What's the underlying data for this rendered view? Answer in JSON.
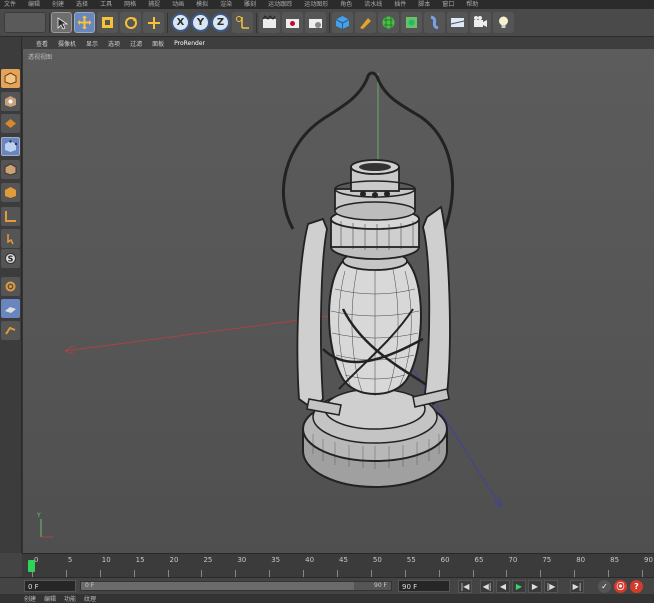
{
  "menubar": {
    "items": [
      "文件",
      "编辑",
      "创建",
      "选择",
      "工具",
      "网格",
      "捕捉",
      "动画",
      "模拟",
      "渲染",
      "雕刻",
      "运动跟踪",
      "运动图形",
      "角色",
      "流水线",
      "插件",
      "脚本",
      "窗口",
      "帮助"
    ]
  },
  "toolbar": {
    "undo_icon": "undo-icon",
    "move_icon": "move-icon",
    "scale_icon": "scale-icon",
    "rotate_icon": "rotate-icon",
    "live_icon": "live-select-icon",
    "x_label": "X",
    "y_label": "Y",
    "z_label": "Z",
    "coord_icon": "coordinate-system-icon",
    "render_icons": [
      "render-view-icon",
      "render-picture-queue-icon",
      "render-settings-icon"
    ],
    "object_icons": [
      "cube-icon",
      "pen-spline-icon",
      "subdivision-surface-icon",
      "array-icon",
      "deformer-icon",
      "scene-environment-icon",
      "camera-icon",
      "light-icon"
    ]
  },
  "viewport_menu": {
    "items": [
      "查看",
      "摄像机",
      "显示",
      "选项",
      "过滤",
      "面板",
      "ProRender"
    ],
    "highlight": "ProRender"
  },
  "left_palette": {
    "icons": [
      "make-editable-icon",
      "model-mode-icon",
      "texture-mode-icon",
      "points-mode-icon",
      "edges-mode-icon",
      "polygons-mode-icon",
      "axis-mode-icon",
      "tweak-mode-icon",
      "snap-icon",
      "soft-selection-icon",
      "workplane-icon",
      "locked-workplane-icon"
    ]
  },
  "viewport": {
    "label": "透视视图",
    "object": "oil-lantern-wireframe"
  },
  "timeline": {
    "ticks": [
      "0",
      "5",
      "10",
      "15",
      "20",
      "25",
      "30",
      "35",
      "40",
      "45",
      "50",
      "55",
      "60",
      "65",
      "70",
      "75",
      "80",
      "85",
      "90"
    ],
    "current_frame": 0
  },
  "transport": {
    "current_field": "0 F",
    "start_field": "0 F",
    "end_field": "90 F",
    "max_field": "90 F",
    "buttons": [
      "first-frame",
      "prev-key",
      "prev-frame",
      "play",
      "next-frame",
      "next-key",
      "last-frame"
    ],
    "button_glyphs": [
      "|◀",
      "◀|",
      "◀",
      "▶",
      "▶",
      "|▶",
      "▶|"
    ],
    "record_glyphs": [
      "✓",
      "⦿",
      "?"
    ]
  },
  "bottom_tabs": {
    "items": [
      "创建",
      "编辑",
      "功能",
      "纹理"
    ]
  },
  "colors": {
    "accent": "#2fd35a",
    "record_red": "#d23a2e",
    "xyz_blue": "#3c5a86"
  }
}
